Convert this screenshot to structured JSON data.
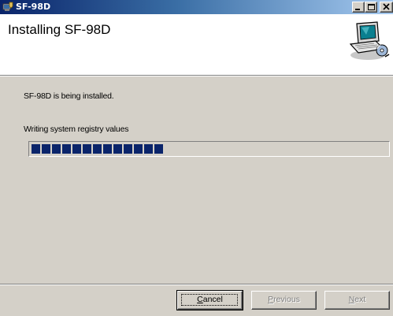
{
  "window": {
    "title": "SF-98D",
    "icons": {
      "app": "installer-icon",
      "minimize": "minimize-icon",
      "maximize": "maximize-icon",
      "close": "close-icon"
    }
  },
  "banner": {
    "title": "Installing SF-98D",
    "icon": "computer-setup-icon"
  },
  "body": {
    "status": "SF-98D is being installed.",
    "action": "Writing system registry values",
    "progress": {
      "filled_blocks": 13
    }
  },
  "buttons": {
    "cancel": {
      "label_underlined": "C",
      "label_rest": "ancel",
      "enabled": true
    },
    "previous": {
      "label_underlined": "P",
      "label_rest": "revious",
      "enabled": false
    },
    "next": {
      "label_underlined": "N",
      "label_rest": "ext",
      "enabled": false
    }
  },
  "colors": {
    "title_gradient_start": "#0a246a",
    "title_gradient_end": "#a6caf0",
    "progress_fill": "#0a246a",
    "window_bg": "#d4d0c8"
  }
}
